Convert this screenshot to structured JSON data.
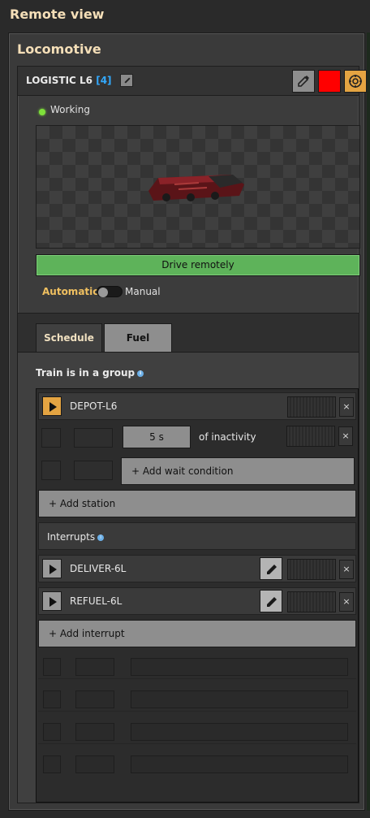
{
  "window": {
    "title": "Remote view"
  },
  "panel": {
    "title": "Locomotive"
  },
  "locomotive": {
    "name": "LOGISTIC L6",
    "count": "[4]",
    "status": "Working",
    "color": "#ff0000"
  },
  "controls": {
    "drive_label": "Drive remotely",
    "automatic_label": "Automatic",
    "manual_label": "Manual"
  },
  "tabs": {
    "schedule": "Schedule",
    "fuel": "Fuel"
  },
  "schedule": {
    "group_label": "Train is in a group",
    "station": {
      "name": "DEPOT-L6"
    },
    "condition": {
      "value": "5 s",
      "text": "of inactivity"
    },
    "add_wait": "+ Add wait condition",
    "add_station": "+ Add station",
    "interrupts_label": "Interrupts",
    "interrupts": [
      {
        "name": "DELIVER-6L"
      },
      {
        "name": "REFUEL-6L"
      }
    ],
    "add_interrupt": "+ Add interrupt",
    "close_symbol": "×"
  }
}
